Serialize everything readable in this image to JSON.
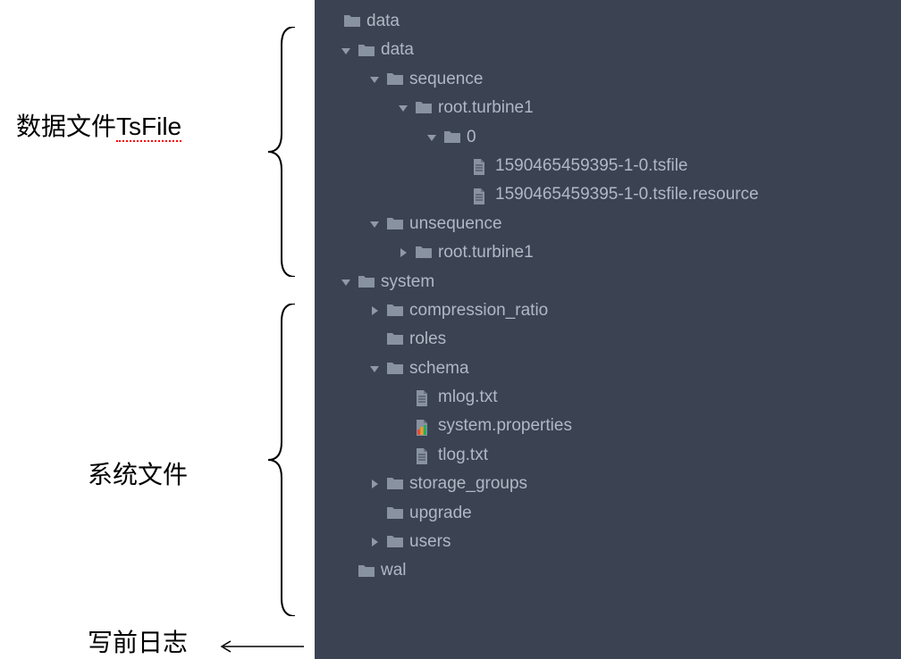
{
  "annotations": {
    "tsfile": "数据文件TsFile",
    "tsfile_text": "TsFile",
    "tsfile_prefix": "数据文件",
    "system": "系统文件",
    "wal": "写前日志"
  },
  "tree": {
    "root": "data",
    "nodes": [
      {
        "indent": 0,
        "expand": "blank",
        "icon": "folder",
        "label": "data"
      },
      {
        "indent": 1,
        "expand": "down",
        "icon": "folder",
        "label": "data"
      },
      {
        "indent": 2,
        "expand": "down",
        "icon": "folder",
        "label": "sequence"
      },
      {
        "indent": 3,
        "expand": "down",
        "icon": "folder",
        "label": "root.turbine1"
      },
      {
        "indent": 4,
        "expand": "down",
        "icon": "folder",
        "label": "0"
      },
      {
        "indent": 5,
        "expand": "blank",
        "icon": "file",
        "label": "1590465459395-1-0.tsfile"
      },
      {
        "indent": 5,
        "expand": "blank",
        "icon": "file",
        "label": "1590465459395-1-0.tsfile.resource"
      },
      {
        "indent": 2,
        "expand": "down",
        "icon": "folder",
        "label": "unsequence"
      },
      {
        "indent": 3,
        "expand": "right",
        "icon": "folder",
        "label": "root.turbine1"
      },
      {
        "indent": 1,
        "expand": "down",
        "icon": "folder",
        "label": "system"
      },
      {
        "indent": 2,
        "expand": "right",
        "icon": "folder",
        "label": "compression_ratio"
      },
      {
        "indent": 2,
        "expand": "blank",
        "icon": "folder",
        "label": "roles"
      },
      {
        "indent": 2,
        "expand": "down",
        "icon": "folder",
        "label": "schema"
      },
      {
        "indent": 3,
        "expand": "blank",
        "icon": "file",
        "label": "mlog.txt"
      },
      {
        "indent": 3,
        "expand": "blank",
        "icon": "props",
        "label": "system.properties"
      },
      {
        "indent": 3,
        "expand": "blank",
        "icon": "file",
        "label": "tlog.txt"
      },
      {
        "indent": 2,
        "expand": "right",
        "icon": "folder",
        "label": "storage_groups"
      },
      {
        "indent": 2,
        "expand": "blank",
        "icon": "folder",
        "label": "upgrade"
      },
      {
        "indent": 2,
        "expand": "right",
        "icon": "folder",
        "label": "users"
      },
      {
        "indent": 1,
        "expand": "blank",
        "icon": "folder",
        "label": "wal"
      }
    ]
  }
}
